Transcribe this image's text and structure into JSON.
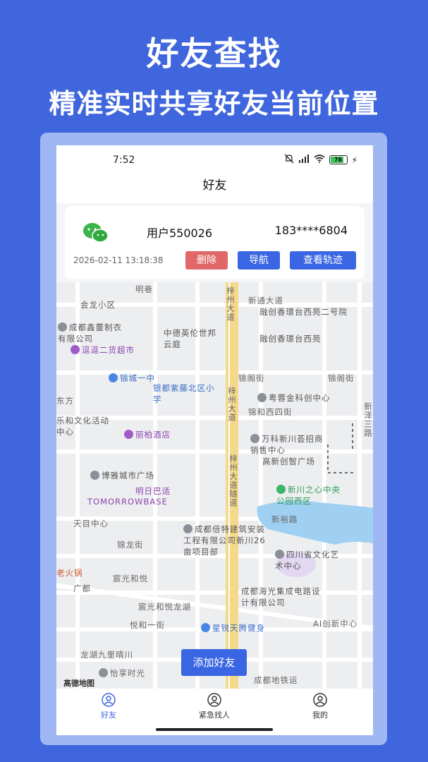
{
  "promo": {
    "title": "好友查找",
    "subtitle": "精准实时共享好友当前位置"
  },
  "status_bar": {
    "time": "7:52",
    "battery_level": "78"
  },
  "nav": {
    "title": "好友"
  },
  "friend": {
    "name": "用户550026",
    "phone": "183****6804",
    "timestamp": "2026-02-11 13:18:38",
    "delete_label": "删除",
    "navigate_label": "导航",
    "track_label": "查看轨迹"
  },
  "map": {
    "roads": {
      "zizhou": "梓州大道",
      "zizhou2": "梓州大道",
      "tunnel": "梓州大道隧道",
      "xintong": "新通大道",
      "jinlong": "锦龙街",
      "jinhe": "锦和西四街",
      "jinge": "锦阁街",
      "jinge2": "锦阁街",
      "yuehe": "悦和一街",
      "xinyu": "新裕路",
      "xinze": "新泽三路"
    },
    "pois": {
      "huilong": "会龙小区",
      "xinpu": "成都鑫蕾制衣有限公司",
      "erhuo": "逗逗二货超市",
      "zhongde": "中德英伦世邦云庭",
      "rongchuang1": "融创香璟台西苑二号院",
      "rongchuang2": "融创香璟台西苑",
      "jincheng": "锦城一中",
      "yindu": "银都紫藤北区小学",
      "yuerun": "粤蓉金科创中心",
      "lehe": "乐和文化活动中心",
      "libai": "丽柏酒店",
      "wanke": "万科新川荟招商销售中心",
      "gaoxin": "高新创智广场",
      "boya": "博雅城市广场",
      "mingri": "明日巴适",
      "tomorrow": "TOMORROWBASE",
      "xinchuan": "新川之心中央公园西区",
      "tianyi": "天目中心",
      "beite": "成都倍特建筑安装工程有限公司新川26亩项目部",
      "sichuan": "四川省文化艺术中心",
      "chenguang": "宸光和悦",
      "chenguang2": "宸光和悦龙湖",
      "haiguang": "成都海光集成电路设计有限公司",
      "xingrui": "星锐天腾健身",
      "longhu": "龙湖九里晴川",
      "yixiang": "怡享时光",
      "aichuang": "AI创新中心",
      "ditie": "成都地铁运",
      "ming": "明巷",
      "dongfang": "东方",
      "guangdu": "广都",
      "laohuo": "老火锅"
    },
    "add_friend_label": "添加好友",
    "provider_logo": "高德地图"
  },
  "tabs": [
    {
      "label": "好友",
      "icon": "person-circle-icon",
      "active": true
    },
    {
      "label": "紧急找人",
      "icon": "person-circle-icon",
      "active": false
    },
    {
      "label": "我的",
      "icon": "person-circle-icon",
      "active": false
    }
  ],
  "colors": {
    "background": "#3f66dd",
    "primary_button": "#3a66e3",
    "delete_button": "#e06868",
    "main_road": "#f5d98a",
    "lake": "#9fd0f2"
  }
}
